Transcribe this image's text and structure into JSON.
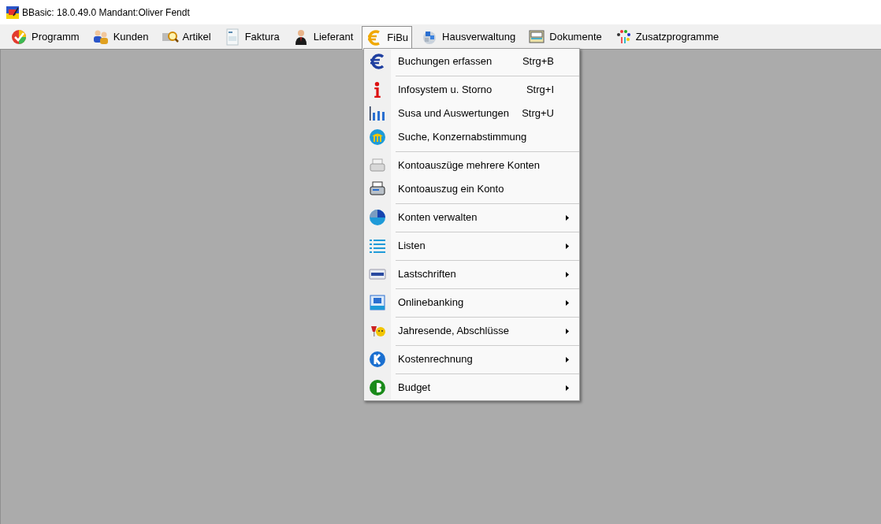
{
  "window": {
    "title": "BBasic: 18.0.49.0 Mandant:Oliver Fendt"
  },
  "menu_bar": [
    {
      "label": "Programm",
      "selected": false
    },
    {
      "label": "Kunden",
      "selected": false
    },
    {
      "label": "Artikel",
      "selected": false
    },
    {
      "label": "Faktura",
      "selected": false
    },
    {
      "label": "Lieferant",
      "selected": false
    },
    {
      "label": "FiBu",
      "selected": true
    },
    {
      "label": "Hausverwaltung",
      "selected": false
    },
    {
      "label": "Dokumente",
      "selected": false
    },
    {
      "label": "Zusatzprogramme",
      "selected": false
    }
  ],
  "dropdown": [
    {
      "label": "Buchungen erfassen",
      "shortcut": "Strg+B",
      "separator_before": false,
      "submenu": false
    },
    {
      "label": "Infosystem u. Storno",
      "shortcut": "Strg+I",
      "separator_before": true,
      "submenu": false
    },
    {
      "label": "Susa und Auswertungen",
      "shortcut": "Strg+U",
      "separator_before": false,
      "submenu": false
    },
    {
      "label": "Suche, Konzernabstimmung",
      "separator_before": false,
      "submenu": false
    },
    {
      "label": "Kontoauszüge mehrere Konten",
      "separator_before": true,
      "submenu": false
    },
    {
      "label": "Kontoauszug ein Konto",
      "separator_before": false,
      "submenu": false
    },
    {
      "label": "Konten verwalten",
      "separator_before": true,
      "submenu": true
    },
    {
      "label": "Listen",
      "separator_before": true,
      "submenu": true
    },
    {
      "label": "Lastschriften",
      "separator_before": true,
      "submenu": true
    },
    {
      "label": "Onlinebanking",
      "separator_before": true,
      "submenu": true
    },
    {
      "label": "Jahresende, Abschlüsse",
      "separator_before": true,
      "submenu": true
    },
    {
      "label": "Kostenrechnung",
      "separator_before": true,
      "submenu": true
    },
    {
      "label": "Budget",
      "separator_before": true,
      "submenu": true
    }
  ]
}
